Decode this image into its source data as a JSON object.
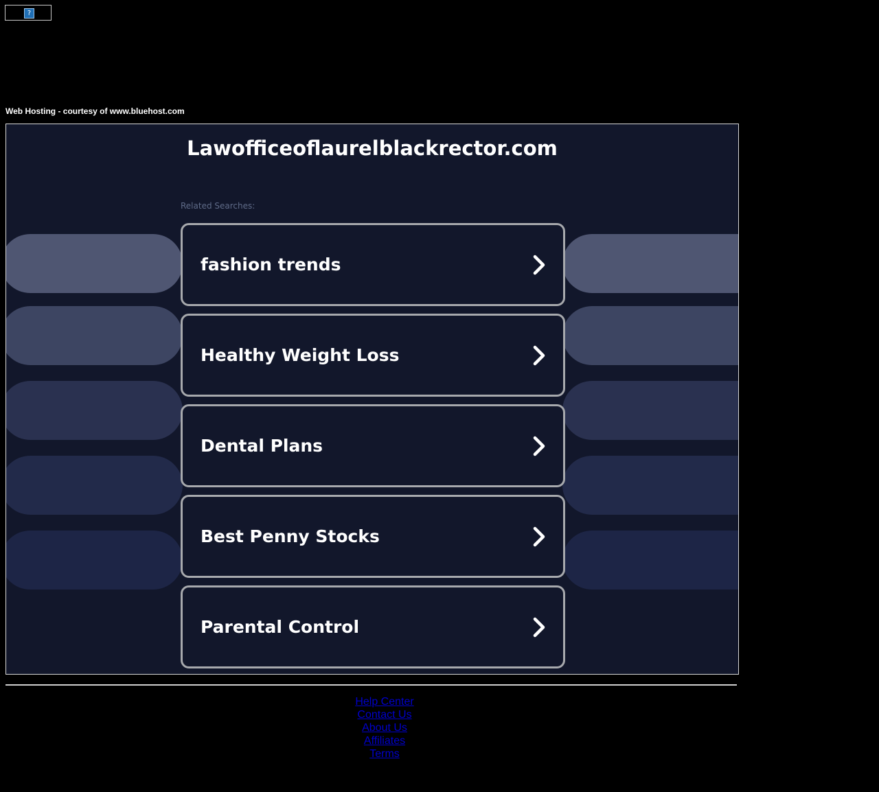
{
  "banner": {
    "placeholder_glyph": "?"
  },
  "hosting_credit": "Web Hosting - courtesy of www.bluehost.com",
  "site": {
    "title": "Lawofficeoflaurelblackrector.com",
    "related_label": "Related Searches:"
  },
  "search_links": [
    {
      "label": "fashion trends"
    },
    {
      "label": "Healthy Weight Loss"
    },
    {
      "label": "Dental Plans"
    },
    {
      "label": "Best Penny Stocks"
    },
    {
      "label": "Parental Control"
    }
  ],
  "footer": {
    "links": [
      {
        "label": "Help Center"
      },
      {
        "label": "Contact Us"
      },
      {
        "label": "About Us"
      },
      {
        "label": "Affiliates"
      },
      {
        "label": "Terms"
      }
    ]
  },
  "colors": {
    "page_bg": "#000000",
    "panel_bg": "#12172b",
    "card_border": "#a7a9ad",
    "link": "#0000cc",
    "pill_shades": [
      "#4f5672",
      "#3d4562",
      "#2a3150",
      "#222a4a",
      "#1d2546"
    ]
  },
  "icons": {
    "card_arrow": "chevron-right-icon",
    "banner_image": "broken-image-icon"
  }
}
